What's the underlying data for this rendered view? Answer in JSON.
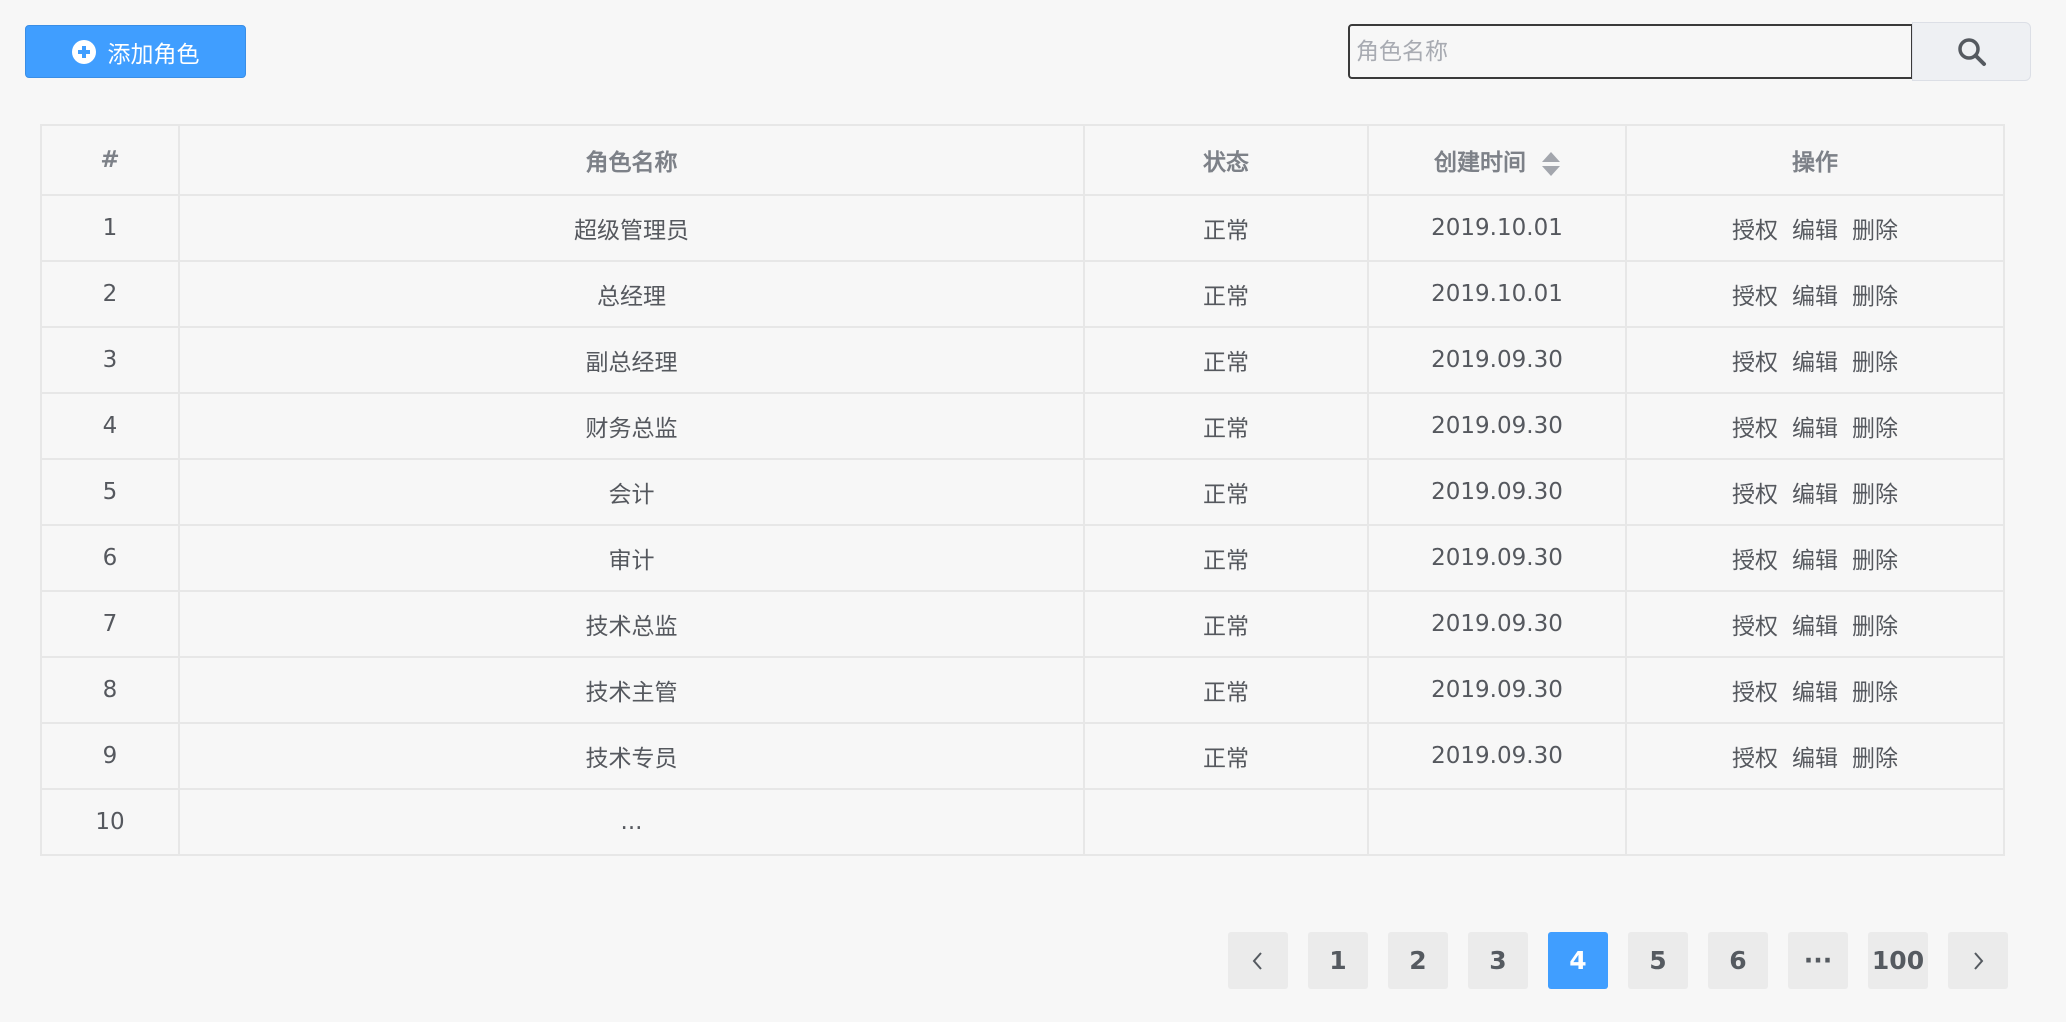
{
  "toolbar": {
    "add_label": "添加角色",
    "search_placeholder": "角色名称"
  },
  "table": {
    "headers": {
      "index": "#",
      "name": "角色名称",
      "status": "状态",
      "created": "创建时间",
      "actions": "操作"
    },
    "rows": [
      {
        "index": "1",
        "name": "超级管理员",
        "status": "正常",
        "created": "2019.10.01",
        "auth": "授权",
        "edit": "编辑",
        "delete": "删除"
      },
      {
        "index": "2",
        "name": "总经理",
        "status": "正常",
        "created": "2019.10.01",
        "auth": "授权",
        "edit": "编辑",
        "delete": "删除"
      },
      {
        "index": "3",
        "name": "副总经理",
        "status": "正常",
        "created": "2019.09.30",
        "auth": "授权",
        "edit": "编辑",
        "delete": "删除"
      },
      {
        "index": "4",
        "name": "财务总监",
        "status": "正常",
        "created": "2019.09.30",
        "auth": "授权",
        "edit": "编辑",
        "delete": "删除"
      },
      {
        "index": "5",
        "name": "会计",
        "status": "正常",
        "created": "2019.09.30",
        "auth": "授权",
        "edit": "编辑",
        "delete": "删除"
      },
      {
        "index": "6",
        "name": "审计",
        "status": "正常",
        "created": "2019.09.30",
        "auth": "授权",
        "edit": "编辑",
        "delete": "删除"
      },
      {
        "index": "7",
        "name": "技术总监",
        "status": "正常",
        "created": "2019.09.30",
        "auth": "授权",
        "edit": "编辑",
        "delete": "删除"
      },
      {
        "index": "8",
        "name": "技术主管",
        "status": "正常",
        "created": "2019.09.30",
        "auth": "授权",
        "edit": "编辑",
        "delete": "删除"
      },
      {
        "index": "9",
        "name": "技术专员",
        "status": "正常",
        "created": "2019.09.30",
        "auth": "授权",
        "edit": "编辑",
        "delete": "删除"
      },
      {
        "index": "10",
        "name": "...",
        "status": "",
        "created": "",
        "auth": "",
        "edit": "",
        "delete": ""
      }
    ]
  },
  "pagination": {
    "prev_icon": "chevron-left-icon",
    "next_icon": "chevron-right-icon",
    "pages": [
      "1",
      "2",
      "3",
      "4",
      "5",
      "6",
      "···",
      "100"
    ],
    "current": "4"
  },
  "colors": {
    "accent": "#409eff",
    "background": "#f7f7f7"
  }
}
